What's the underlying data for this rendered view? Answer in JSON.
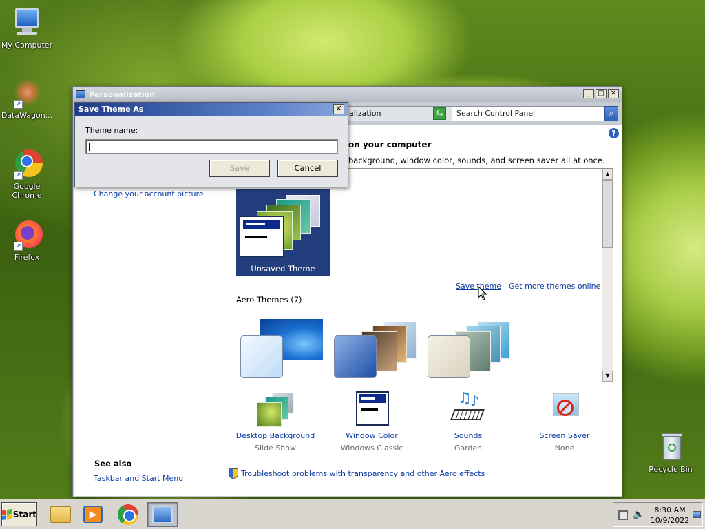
{
  "desktop": {
    "icons": [
      {
        "label": "My Computer"
      },
      {
        "label": "DataWagon..."
      },
      {
        "label": "Google Chrome"
      },
      {
        "label": "Firefox"
      },
      {
        "label": "Recycle Bin"
      }
    ]
  },
  "window": {
    "title": "Personalization",
    "controls": {
      "minimize": "_",
      "maximize": "□",
      "close": "✕"
    },
    "address": "alization",
    "search_placeholder": "Search Control Panel",
    "help": "?",
    "headline": "on your computer",
    "subline": "background, window color, sounds, and screen saver all at once.",
    "side_links": [
      "Change your account picture"
    ],
    "see_also": {
      "title": "See also",
      "links": [
        "Taskbar and Start Menu"
      ]
    },
    "my_theme": {
      "name": "Unsaved Theme"
    },
    "theme_actions": {
      "save": "Save theme",
      "get_more": "Get more themes online"
    },
    "aero_section": "Aero Themes (7)",
    "settings": [
      {
        "name": "Desktop Background",
        "value": "Slide Show",
        "icon": "desktop-background-icon"
      },
      {
        "name": "Window Color",
        "value": "Windows Classic",
        "icon": "window-color-icon"
      },
      {
        "name": "Sounds",
        "value": "Garden",
        "icon": "sounds-icon"
      },
      {
        "name": "Screen Saver",
        "value": "None",
        "icon": "screen-saver-icon"
      }
    ],
    "troubleshoot": "Troubleshoot problems with transparency and other Aero effects"
  },
  "dialog": {
    "title": "Save Theme As",
    "close": "✕",
    "label": "Theme name:",
    "input_value": "",
    "save": "Save",
    "cancel": "Cancel"
  },
  "taskbar": {
    "start": "Start",
    "time": "8:30 AM",
    "date": "10/9/2022"
  }
}
